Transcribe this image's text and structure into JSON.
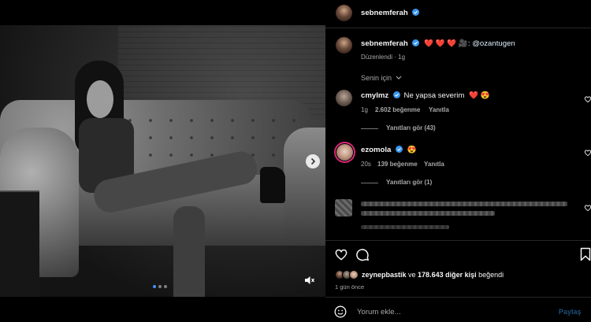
{
  "post": {
    "author": "sebnemferah",
    "caption_hearts": "❤️ ❤️ ❤️",
    "caption_camera": "🎥",
    "caption_mention": ": @ozantugen",
    "edited_label": "Düzenlendi",
    "edited_dot": "·",
    "edited_time": "1g",
    "likes_user": "zeynepbastik",
    "likes_mid": " ve ",
    "likes_count": "178.643 diğer kişi",
    "likes_end": " beğendi",
    "posted_time": "1 gün önce"
  },
  "for_you": {
    "label": "Senin için"
  },
  "comments": [
    {
      "user": "cmylmz",
      "text": "Ne yapsa severim",
      "emoji1": "❤️",
      "emoji2": "😍",
      "time": "1g",
      "likes": "2.602 beğenme",
      "reply_label": "Yanıtla",
      "view_replies": "Yanıtları gör (43)"
    },
    {
      "user": "ezomola",
      "emoji": "😍",
      "time": "20s",
      "likes": "139 beğenme",
      "reply_label": "Yanıtla",
      "view_replies": "Yanıtları gör (1)"
    }
  ],
  "input": {
    "placeholder": "Yorum ekle...",
    "post_label": "Paylaş"
  },
  "colors": {
    "verified": "#3897f0",
    "heart": "#ff3040",
    "panel_bg": "#000000"
  }
}
